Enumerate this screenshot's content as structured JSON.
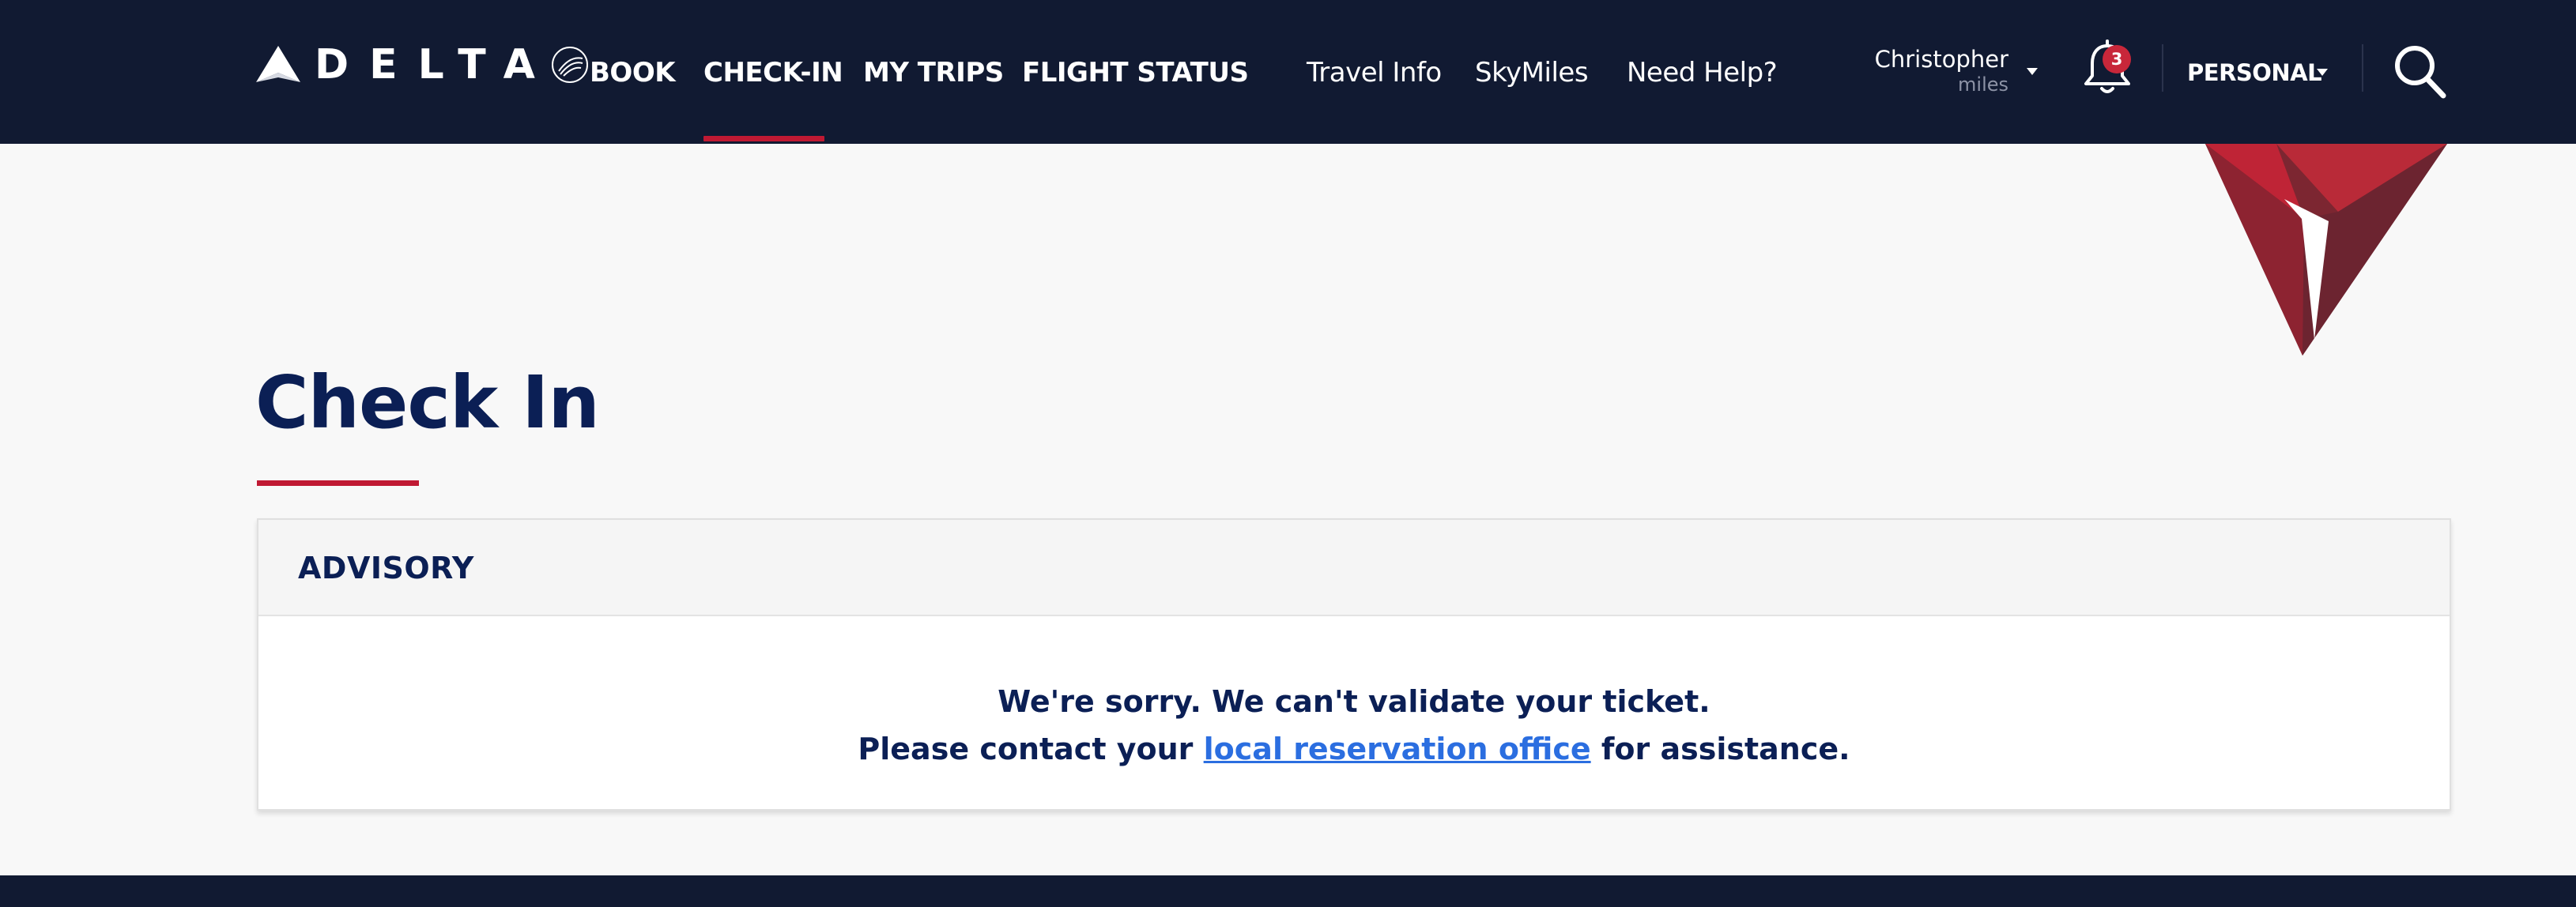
{
  "header": {
    "logo_text": "DELTA",
    "nav_primary": [
      "BOOK",
      "CHECK-IN",
      "MY TRIPS",
      "FLIGHT STATUS"
    ],
    "nav_secondary": [
      "Travel Info",
      "SkyMiles",
      "Need Help?"
    ],
    "active_nav": "CHECK-IN",
    "user": {
      "name": "Christopher",
      "miles_label": "miles"
    },
    "notifications": {
      "count": "3"
    },
    "account_type": "PERSONAL",
    "icons": [
      "delta-widget-icon",
      "skyteam-seal-icon",
      "bell-icon",
      "search-icon",
      "chevron-down-icon"
    ]
  },
  "page": {
    "title": "Check In"
  },
  "advisory": {
    "heading": "ADVISORY",
    "line1": "We're sorry. We can't validate your ticket.",
    "line2_before": "Please contact your ",
    "line2_link": "local reservation office",
    "line2_after": " for assistance."
  },
  "colors": {
    "header_bg": "#111a32",
    "accent_red": "#c01933",
    "title_navy": "#0b1f55",
    "link_blue": "#2b6ee0",
    "page_bg": "#f8f8f8"
  }
}
